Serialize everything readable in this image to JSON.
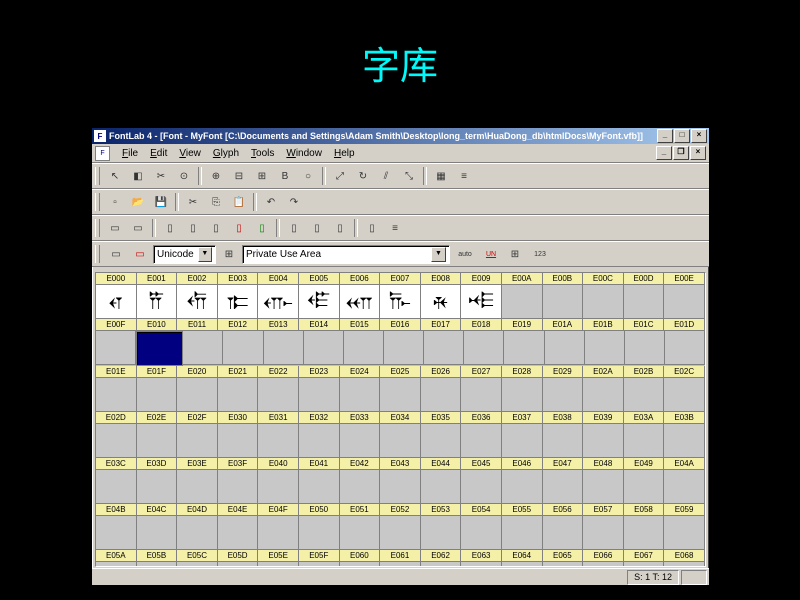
{
  "slide_title": "字库",
  "window": {
    "title": "FontLab 4 - [Font - MyFont [C:\\Documents and Settings\\Adam Smith\\Desktop\\long_term\\HuaDong_db\\htmlDocs\\MyFont.vfb]]"
  },
  "menu": [
    "File",
    "Edit",
    "View",
    "Glyph",
    "Tools",
    "Window",
    "Help"
  ],
  "range_dropdown": {
    "label": "Unicode",
    "area": "Private Use Area"
  },
  "side_buttons": [
    "auto",
    "UN",
    "⊞",
    "123"
  ],
  "grid": {
    "cols": 15,
    "rows": [
      {
        "labels": [
          "E000",
          "E001",
          "E002",
          "E003",
          "E004",
          "E005",
          "E006",
          "E007",
          "E008",
          "E009",
          "E00A",
          "E00B",
          "E00C",
          "E00D",
          "E00E"
        ],
        "glyphs": [
          0,
          1,
          2,
          3,
          4,
          5,
          6,
          7,
          8,
          9
        ]
      },
      {
        "labels": [
          "E00F",
          "E010",
          "E011",
          "E012",
          "E013",
          "E014",
          "E015",
          "E016",
          "E017",
          "E018",
          "E019",
          "E01A",
          "E01B",
          "E01C",
          "E01D"
        ],
        "selected": 1
      },
      {
        "labels": [
          "E01E",
          "E01F",
          "E020",
          "E021",
          "E022",
          "E023",
          "E024",
          "E025",
          "E026",
          "E027",
          "E028",
          "E029",
          "E02A",
          "E02B",
          "E02C"
        ]
      },
      {
        "labels": [
          "E02D",
          "E02E",
          "E02F",
          "E030",
          "E031",
          "E032",
          "E033",
          "E034",
          "E035",
          "E036",
          "E037",
          "E038",
          "E039",
          "E03A",
          "E03B"
        ]
      },
      {
        "labels": [
          "E03C",
          "E03D",
          "E03E",
          "E03F",
          "E040",
          "E041",
          "E042",
          "E043",
          "E044",
          "E045",
          "E046",
          "E047",
          "E048",
          "E049",
          "E04A"
        ]
      },
      {
        "labels": [
          "E04B",
          "E04C",
          "E04D",
          "E04E",
          "E04F",
          "E050",
          "E051",
          "E052",
          "E053",
          "E054",
          "E055",
          "E056",
          "E057",
          "E058",
          "E059"
        ]
      },
      {
        "labels": [
          "E05A",
          "E05B",
          "E05C",
          "E05D",
          "E05E",
          "E05F",
          "E060",
          "E061",
          "E062",
          "E063",
          "E064",
          "E065",
          "E066",
          "E067",
          "E068"
        ]
      }
    ],
    "glyph_chars": [
      "𐎤",
      "𐎡",
      "𐎢",
      "𐎣",
      "𐎥",
      "𐎦",
      "𐎧",
      "𐎨",
      "𐎩",
      "𐎪"
    ]
  },
  "status": {
    "st": "S: 1 T: 12"
  }
}
